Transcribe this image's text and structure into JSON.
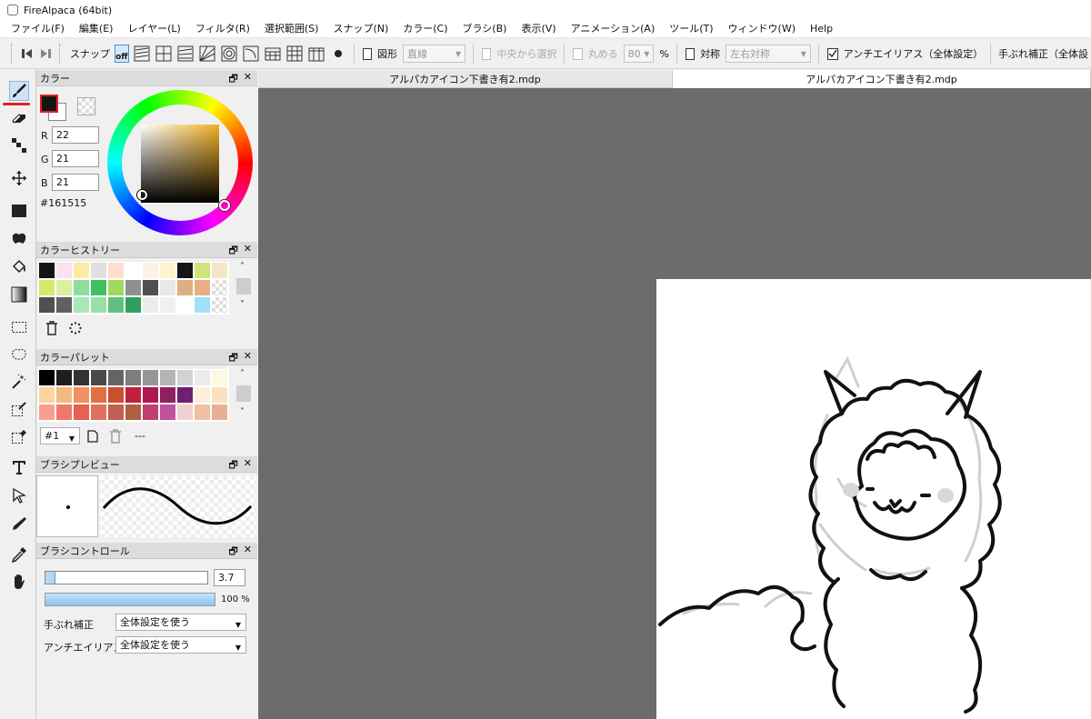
{
  "window": {
    "title": "FireAlpaca (64bit)"
  },
  "menu": [
    "ファイル(F)",
    "編集(E)",
    "レイヤー(L)",
    "フィルタ(R)",
    "選択範囲(S)",
    "スナップ(N)",
    "カラー(C)",
    "ブラシ(B)",
    "表示(V)",
    "アニメーション(A)",
    "ツール(T)",
    "ウィンドウ(W)",
    "Help"
  ],
  "toolbar": {
    "snap_label": "スナップ",
    "snap_off_label": "off",
    "shape_label": "図形",
    "shape_value": "直線",
    "from_center_label": "中央から選択",
    "round_label": "丸める",
    "round_value": "80",
    "round_unit": "%",
    "symmetry_label": "対称",
    "symmetry_value": "左右対称",
    "antialias_label": "アンチエイリアス（全体設定）",
    "stabilizer_label": "手ぶれ補正（全体設"
  },
  "tools": [
    "brush-tool",
    "eraser-tool",
    "dot-tool",
    "move-tool",
    "fill-rect-tool",
    "fill-lasso-tool",
    "bucket-tool",
    "gradient-tool",
    "select-tool",
    "lasso-tool",
    "magic-wand-tool",
    "select-pen-tool",
    "select-eraser-tool",
    "text-tool",
    "operation-tool",
    "divide-tool",
    "eyedropper-tool",
    "hand-tool"
  ],
  "color_panel": {
    "title": "カラー",
    "r_label": "R",
    "r": "22",
    "g_label": "G",
    "g": "21",
    "b_label": "B",
    "b": "21",
    "hex": "#161515",
    "fg_color": "#161515",
    "bg_color": "#ffffff"
  },
  "history_panel": {
    "title": "カラーヒストリー",
    "swatches": [
      "#161515",
      "#fbe0ef",
      "#fdeaa5",
      "#e0e0e0",
      "#fde0d0",
      "#ffffff",
      "#fdf3e3",
      "#fdf3d0",
      "#161515",
      "#cfe57a",
      "#f5e6c8",
      "#d4e86a",
      "#d8f0a0",
      "#90dca0",
      "#40c060",
      "#a0d860",
      "#909090",
      "#505050",
      "#e8e8e8",
      "#dcb080",
      "#e8b080",
      "",
      "#505050",
      "#606060",
      "#a8e8b8",
      "#98e0a8",
      "#60c080",
      "#30a060",
      "#ececec",
      "#f0f0f0",
      "#ffffff",
      "#a0e0f8",
      ""
    ]
  },
  "palette_panel": {
    "title": "カラーパレット",
    "swatches": [
      "#000000",
      "#1e1e1e",
      "#323232",
      "#4a4a4a",
      "#646464",
      "#7d7d7d",
      "#969696",
      "#b4b4b4",
      "#d2d2d2",
      "#ebebeb",
      "#fff8e0",
      "#fdd3a0",
      "#f4b880",
      "#f09060",
      "#e07040",
      "#c85030",
      "#c02040",
      "#b01850",
      "#902060",
      "#702070",
      "#fdf0d8",
      "#fde0c0",
      "#f8a090",
      "#f07868",
      "#e86050",
      "#e07060",
      "#c06050",
      "#b06040",
      "#c04070",
      "#c050a0",
      "#f0d0d0",
      "#f0c0a0",
      "#e8b090"
    ],
    "palette_select": "#1",
    "palette_name": "---"
  },
  "brush_preview_panel": {
    "title": "ブラシプレビュー"
  },
  "brush_control_panel": {
    "title": "ブラシコントロール",
    "size_value": "3.7",
    "size_fraction": 0.06,
    "opacity_value": "100 %",
    "opacity_fraction": 1.0,
    "stabilizer_label": "手ぶれ補正",
    "stabilizer_value": "全体設定を使う",
    "antialias_label": "アンチエイリアス",
    "antialias_value": "全体設定を使う"
  },
  "tabs": [
    {
      "label": "アルパカアイコン下書き有2.mdp",
      "active": false
    },
    {
      "label": "アルパカアイコン下書き有2.mdp",
      "active": true
    }
  ]
}
